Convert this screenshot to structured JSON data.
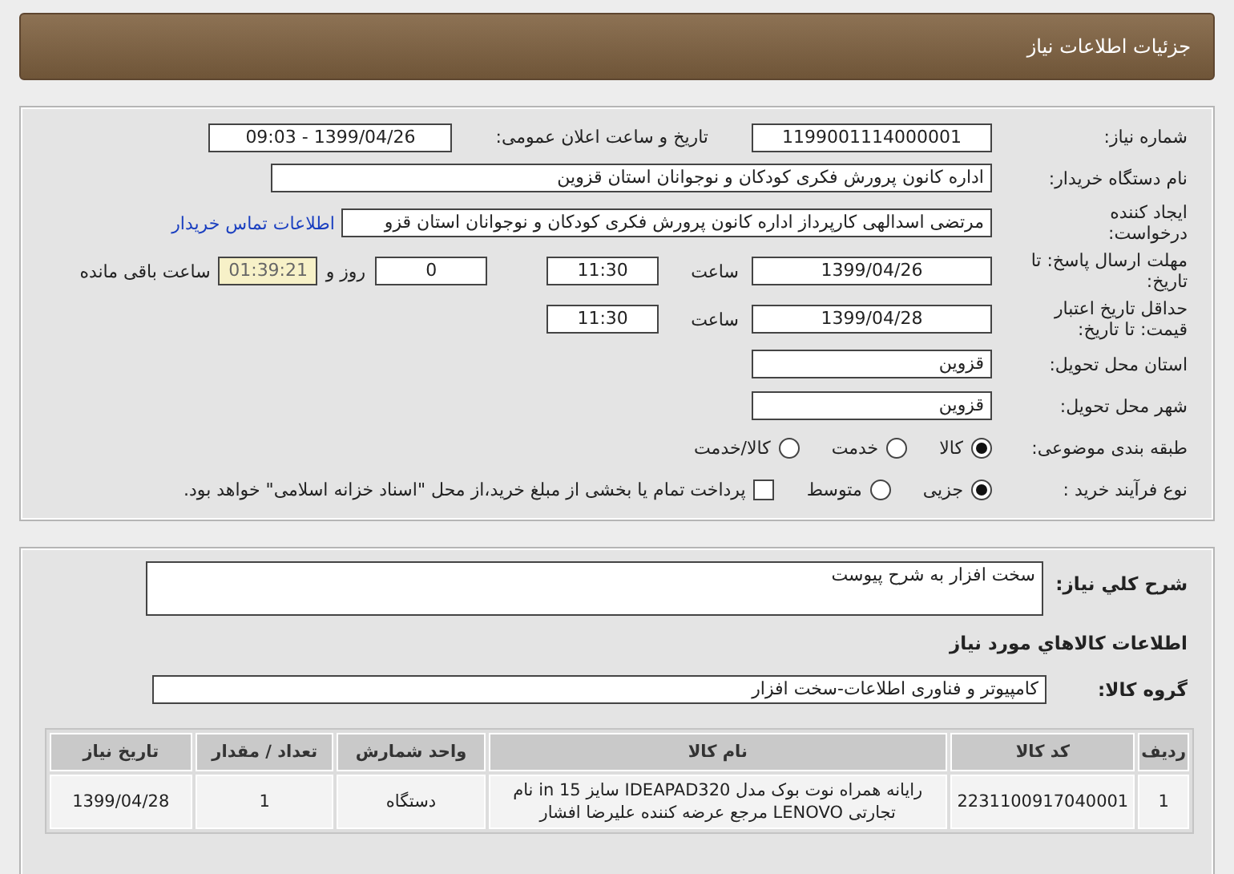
{
  "header": {
    "title": "جزئیات اطلاعات نیاز"
  },
  "details": {
    "need_number": {
      "label": "شماره نیاز:",
      "value": "1199001114000001"
    },
    "announce": {
      "label": "تاریخ و ساعت اعلان عمومی:",
      "value": "1399/04/26 - 09:03"
    },
    "buyer": {
      "label": "نام دستگاه خریدار:",
      "value": "اداره کانون پرورش فکری کودکان و نوجوانان استان قزوین"
    },
    "requester": {
      "label": "ایجاد کننده درخواست:",
      "value": "مرتضی اسدالهی کارپرداز اداره کانون پرورش فکری کودکان و نوجوانان استان قزو",
      "link": "اطلاعات تماس خریدار"
    },
    "deadline": {
      "label": "مهلت ارسال پاسخ: تا تاریخ:",
      "date": "1399/04/26",
      "time_label": "ساعت",
      "time": "11:30",
      "days": "0",
      "days_label": "روز و",
      "remaining": "01:39:21",
      "remaining_label": "ساعت باقی مانده"
    },
    "validity": {
      "label": "حداقل تاریخ اعتبار قیمت: تا تاریخ:",
      "date": "1399/04/28",
      "time_label": "ساعت",
      "time": "11:30"
    },
    "province": {
      "label": "استان محل تحویل:",
      "value": "قزوین"
    },
    "city": {
      "label": "شهر محل تحویل:",
      "value": "قزوین"
    },
    "category": {
      "label": "طبقه بندی موضوعی:",
      "options": [
        {
          "label": "کالا",
          "selected": true
        },
        {
          "label": "خدمت",
          "selected": false
        },
        {
          "label": "کالا/خدمت",
          "selected": false
        }
      ]
    },
    "process": {
      "label": "نوع فرآیند خرید :",
      "options": [
        {
          "label": "جزیی",
          "selected": true
        },
        {
          "label": "متوسط",
          "selected": false
        }
      ],
      "treasury": {
        "label": "پرداخت تمام یا بخشی از مبلغ خرید،از محل \"اسناد خزانه اسلامی\" خواهد بود.",
        "checked": false
      }
    }
  },
  "items": {
    "description": {
      "label": "شرح کلي نياز:",
      "value": "سخت افزار به شرح پیوست"
    },
    "section_title": "اطلاعات کالاهاي مورد نياز",
    "group": {
      "label": "گروه کالا:",
      "value": "کامپیوتر و فناوری اطلاعات-سخت افزار"
    },
    "table": {
      "columns": [
        "ردیف",
        "کد کالا",
        "نام کالا",
        "واحد شمارش",
        "تعداد / مقدار",
        "تاریخ نیاز"
      ],
      "rows": [
        [
          "1",
          "2231100917040001",
          "رایانه همراه نوت بوک مدل IDEAPAD320 سایز 15 in نام تجارتی LENOVO مرجع عرضه کننده علیرضا افشار",
          "دستگاه",
          "1",
          "1399/04/28"
        ]
      ]
    }
  }
}
